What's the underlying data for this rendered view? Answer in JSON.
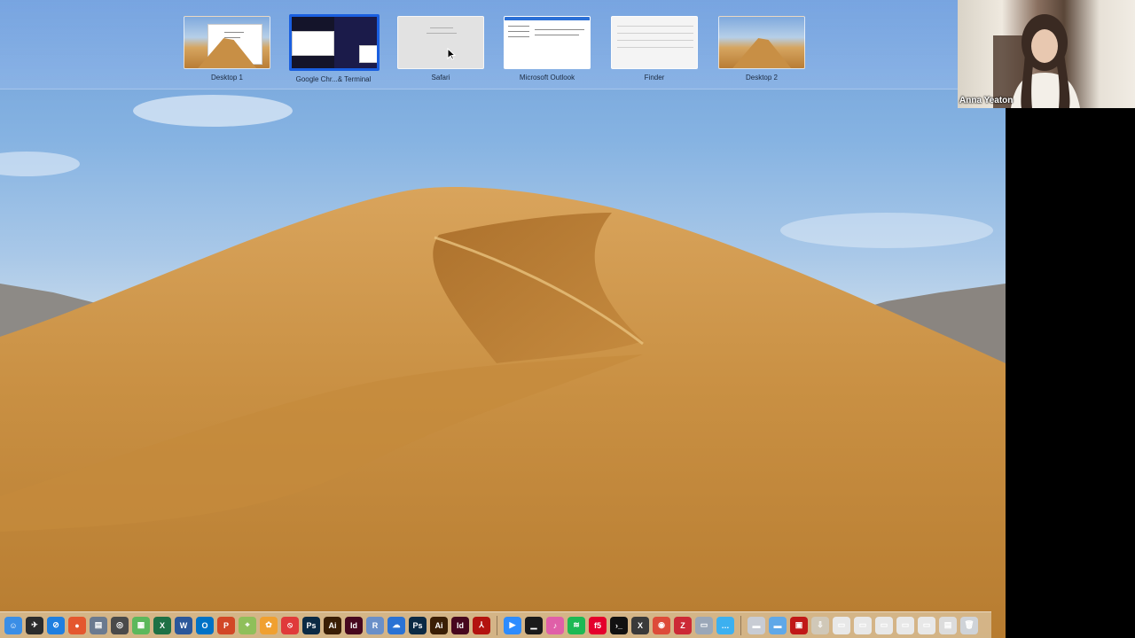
{
  "mission_control": {
    "spaces": [
      {
        "label": "Desktop 1",
        "kind": "desktop"
      },
      {
        "label": "Google Chr...& Terminal",
        "kind": "split",
        "selected": true
      },
      {
        "label": "Safari",
        "kind": "app"
      },
      {
        "label": "Microsoft Outlook",
        "kind": "app"
      },
      {
        "label": "Finder",
        "kind": "app"
      },
      {
        "label": "Desktop 2",
        "kind": "desktop"
      }
    ]
  },
  "webcam": {
    "participant_name": "Anna Yeaton"
  },
  "dock": {
    "apps": [
      {
        "icon": "finder-icon",
        "color": "#3a8ee6",
        "glyph": "☺"
      },
      {
        "icon": "launchpad-icon",
        "color": "#2c2c2c",
        "glyph": "✈"
      },
      {
        "icon": "safari-icon",
        "color": "#1f7fe0",
        "glyph": "⊘"
      },
      {
        "icon": "firefox-icon",
        "color": "#e4572e",
        "glyph": "●"
      },
      {
        "icon": "preview-icon",
        "color": "#6b7a8f",
        "glyph": "▤"
      },
      {
        "icon": "spiral-app-icon",
        "color": "#4a4a4a",
        "glyph": "◎"
      },
      {
        "icon": "maps-icon",
        "color": "#5cb85c",
        "glyph": "▦"
      },
      {
        "icon": "excel-icon",
        "color": "#1e7145",
        "glyph": "X"
      },
      {
        "icon": "word-icon",
        "color": "#2b579a",
        "glyph": "W"
      },
      {
        "icon": "outlook-icon",
        "color": "#0072c6",
        "glyph": "O"
      },
      {
        "icon": "powerpoint-icon",
        "color": "#d24726",
        "glyph": "P"
      },
      {
        "icon": "maps-2-icon",
        "color": "#8fbf5a",
        "glyph": "⌖"
      },
      {
        "icon": "photos-icon",
        "color": "#f0a030",
        "glyph": "✿"
      },
      {
        "icon": "no-entry-icon",
        "color": "#e03a3a",
        "glyph": "⦸"
      },
      {
        "icon": "photoshop-icon",
        "color": "#0b2a44",
        "glyph": "Ps"
      },
      {
        "icon": "illustrator-icon",
        "color": "#3a1e05",
        "glyph": "Ai"
      },
      {
        "icon": "indesign-icon",
        "color": "#47071e",
        "glyph": "Id"
      },
      {
        "icon": "r-app-icon",
        "color": "#6a8fc8",
        "glyph": "R"
      },
      {
        "icon": "onedrive-icon",
        "color": "#2a72d4",
        "glyph": "☁"
      },
      {
        "icon": "photoshop-2-icon",
        "color": "#0b2a44",
        "glyph": "Ps"
      },
      {
        "icon": "illustrator-2-icon",
        "color": "#3a1e05",
        "glyph": "Ai"
      },
      {
        "icon": "indesign-2-icon",
        "color": "#47071e",
        "glyph": "Id"
      },
      {
        "icon": "acrobat-icon",
        "color": "#b3130f",
        "glyph": "⅄"
      },
      {
        "sep": true
      },
      {
        "icon": "zoom-icon",
        "color": "#2d8cff",
        "glyph": "▶"
      },
      {
        "icon": "activity-monitor-icon",
        "color": "#1a1a1a",
        "glyph": "▁"
      },
      {
        "icon": "itunes-icon",
        "color": "#e05fa8",
        "glyph": "♪"
      },
      {
        "icon": "spotify-icon",
        "color": "#1db954",
        "glyph": "≋"
      },
      {
        "icon": "f5-icon",
        "color": "#e4002b",
        "glyph": "f5"
      },
      {
        "icon": "terminal-icon",
        "color": "#111111",
        "glyph": "›_"
      },
      {
        "icon": "x11-icon",
        "color": "#3a3a3a",
        "glyph": "X"
      },
      {
        "icon": "chrome-icon",
        "color": "#dd4b39",
        "glyph": "◉"
      },
      {
        "icon": "zotero-icon",
        "color": "#cc2936",
        "glyph": "Z"
      },
      {
        "icon": "preview-2-icon",
        "color": "#9aa7b8",
        "glyph": "▭"
      },
      {
        "icon": "messages-icon",
        "color": "#3cb0f0",
        "glyph": "…"
      },
      {
        "sep": true
      },
      {
        "icon": "documents-folder-icon",
        "color": "#c8ccd4",
        "glyph": "▬"
      },
      {
        "icon": "folder-icon",
        "color": "#5fa8e8",
        "glyph": "▬"
      },
      {
        "icon": "pdf-document-icon",
        "color": "#c01818",
        "glyph": "▣"
      },
      {
        "icon": "downloads-icon",
        "color": "#d0c8b8",
        "glyph": "⇩"
      },
      {
        "icon": "file-icon",
        "color": "#e8e8e8",
        "glyph": "▭"
      },
      {
        "icon": "file-2-icon",
        "color": "#e8e8e8",
        "glyph": "▭"
      },
      {
        "icon": "file-3-icon",
        "color": "#e8e8e8",
        "glyph": "▭"
      },
      {
        "icon": "file-4-icon",
        "color": "#e8e8e8",
        "glyph": "▭"
      },
      {
        "icon": "file-5-icon",
        "color": "#e8e8e8",
        "glyph": "▭"
      },
      {
        "icon": "file-6-icon",
        "color": "#dcdcdc",
        "glyph": "▤"
      },
      {
        "icon": "trash-icon",
        "color": "#cfd3d8",
        "glyph": "🗑"
      }
    ]
  }
}
